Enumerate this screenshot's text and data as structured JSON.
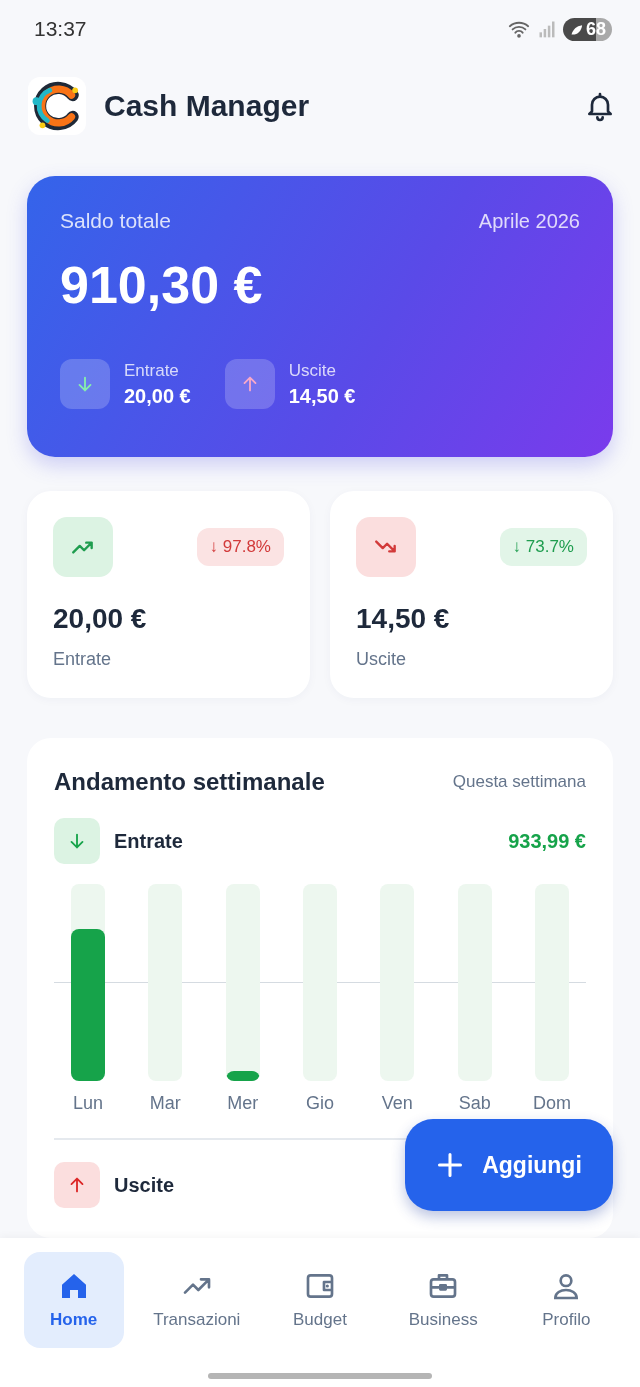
{
  "status_bar": {
    "time": "13:37",
    "battery": "68"
  },
  "header": {
    "title": "Cash Manager"
  },
  "balance": {
    "label": "Saldo totale",
    "period": "Aprile 2026",
    "amount": "910,30 €",
    "flows": [
      {
        "kind": "in",
        "label": "Entrate",
        "amount": "20,00 €"
      },
      {
        "kind": "out",
        "label": "Uscite",
        "amount": "14,50 €"
      }
    ]
  },
  "stats": [
    {
      "kind": "in",
      "change": "↓ 97.8%",
      "favorable": false,
      "amount": "20,00 €",
      "label": "Entrate"
    },
    {
      "kind": "out",
      "change": "↓ 73.7%",
      "favorable": true,
      "amount": "14,50 €",
      "label": "Uscite"
    }
  ],
  "weekly": {
    "title": "Andamento settimanale",
    "period": "Questa settimana",
    "sections": [
      {
        "kind": "in",
        "label": "Entrate",
        "total": "933,99 €",
        "days": [
          {
            "label": "Lun",
            "level": 0.77
          },
          {
            "label": "Mar",
            "level": 0
          },
          {
            "label": "Mer",
            "level": 0.05
          },
          {
            "label": "Gio",
            "level": 0
          },
          {
            "label": "Ven",
            "level": 0
          },
          {
            "label": "Sab",
            "level": 0
          },
          {
            "label": "Dom",
            "level": 0
          }
        ]
      },
      {
        "kind": "out",
        "label": "Uscite"
      }
    ]
  },
  "fab": {
    "label": "Aggiungi"
  },
  "nav": [
    {
      "kind": "home",
      "label": "Home",
      "selected": true
    },
    {
      "kind": "trend",
      "label": "Transazioni",
      "selected": false
    },
    {
      "kind": "wallet",
      "label": "Budget",
      "selected": false
    },
    {
      "kind": "briefcase",
      "label": "Business",
      "selected": false
    },
    {
      "kind": "person",
      "label": "Profilo",
      "selected": false
    }
  ]
}
